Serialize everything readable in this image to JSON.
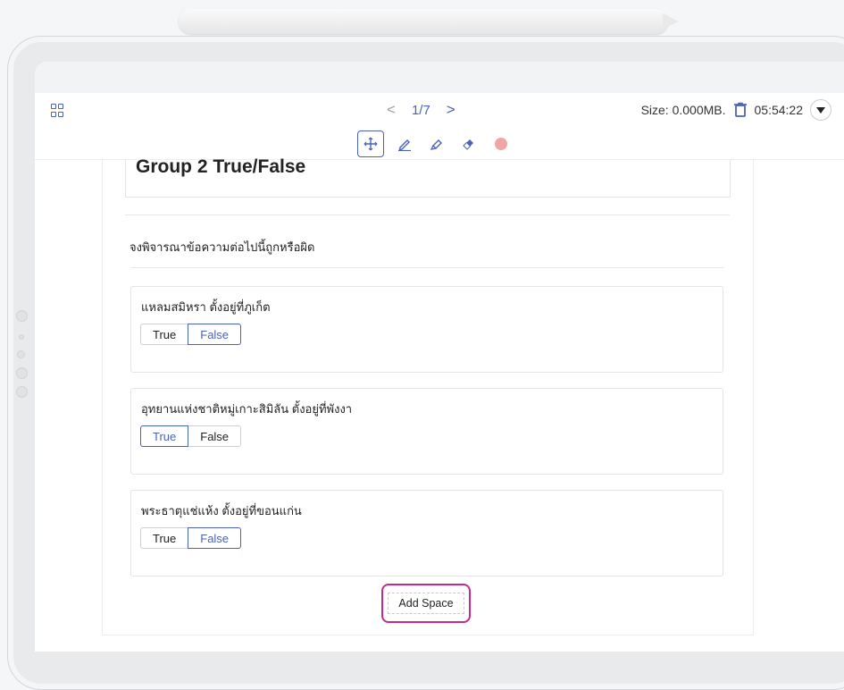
{
  "pager": {
    "prev": "<",
    "page": "1/7",
    "next": ">"
  },
  "info": {
    "size": "Size: 0.000MB.",
    "time": "05:54:22"
  },
  "colors": {
    "accent": "#4a62b8",
    "highlight": "#c8288d",
    "record": "#f2a5a5"
  },
  "tools": [
    "move-icon",
    "pen-icon",
    "highlighter-icon",
    "eraser-icon",
    "record-dot"
  ],
  "page": {
    "title": "Group 2 True/False",
    "instruction": "จงพิจารณาข้อความต่อไปนี้ถูกหรือผิด",
    "questions": [
      {
        "text": "แหลมสมิหรา ตั้งอยู่ที่ภูเก็ต",
        "true_label": "True",
        "false_label": "False",
        "selected": "False"
      },
      {
        "text": "อุทยานแห่งชาติหมู่เกาะสิมิลัน ตั้งอยู่ที่พังงา",
        "true_label": "True",
        "false_label": "False",
        "selected": "True"
      },
      {
        "text": "พระธาตุแช่แห้ง ตั้งอยู่ที่ขอนแก่น",
        "true_label": "True",
        "false_label": "False",
        "selected": "False"
      }
    ],
    "add_space": "Add Space"
  }
}
